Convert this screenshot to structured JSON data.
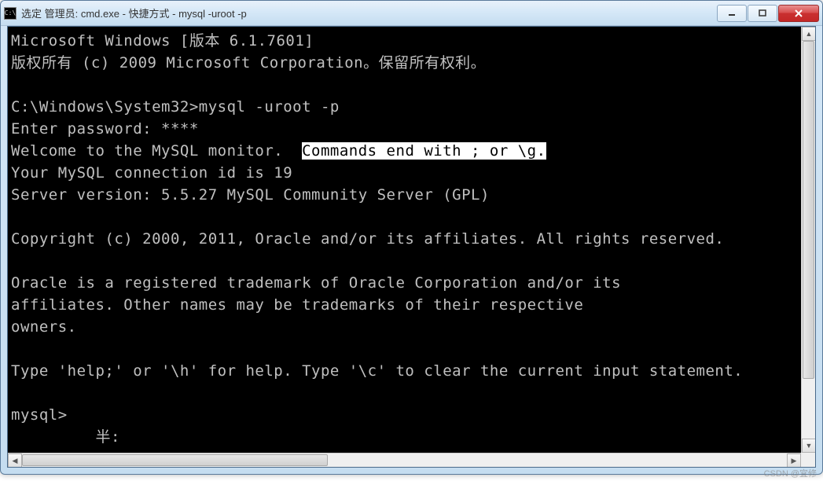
{
  "window": {
    "icon_label": "C:\\",
    "title": "选定 管理员: cmd.exe - 快捷方式 - mysql  -uroot -p"
  },
  "terminal": {
    "lines": [
      "Microsoft Windows [版本 6.1.7601]",
      "版权所有 (c) 2009 Microsoft Corporation。保留所有权利。",
      "",
      "C:\\Windows\\System32>mysql -uroot -p",
      "Enter password: ****"
    ],
    "welcome_prefix": "Welcome to the MySQL monitor.  ",
    "welcome_highlight": "Commands end with ; or \\g.",
    "lines_after": [
      "Your MySQL connection id is 19",
      "Server version: 5.5.27 MySQL Community Server (GPL)",
      "",
      "Copyright (c) 2000, 2011, Oracle and/or its affiliates. All rights reserved.",
      "",
      "Oracle is a registered trademark of Oracle Corporation and/or its",
      "affiliates. Other names may be trademarks of their respective",
      "owners.",
      "",
      "Type 'help;' or '\\h' for help. Type '\\c' to clear the current input statement.",
      "",
      "mysql>",
      "         半:"
    ]
  },
  "watermark": "CSDN @宜修"
}
